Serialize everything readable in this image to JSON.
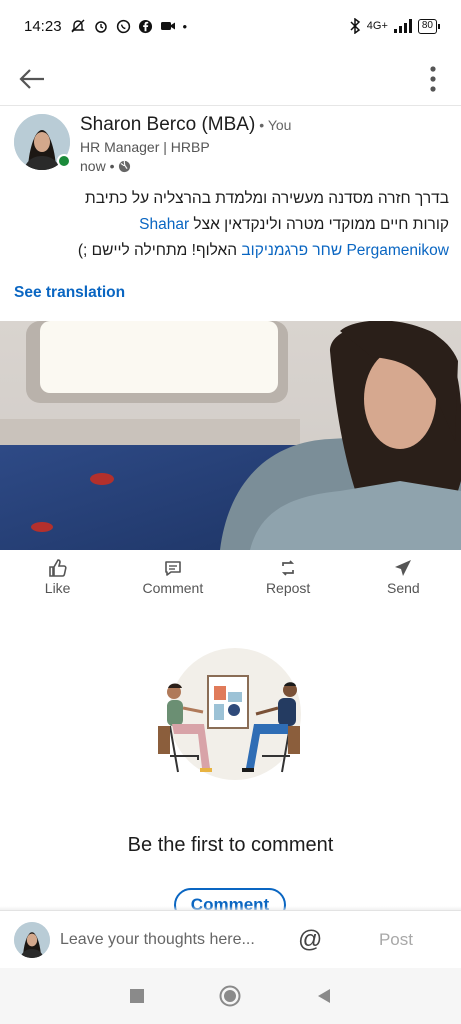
{
  "status_bar": {
    "time": "14:23",
    "network": "4G+",
    "battery": "80"
  },
  "post": {
    "author_name": "Sharon Berco (MBA)",
    "author_relation": "• You",
    "author_headline": "HR Manager | HRBP",
    "time": "now •",
    "text_line1": "בדרך חזרה מסדנה מעשירה ומלמדת בהרצליה על כתיבת",
    "text_line2_prefix": "קורות חיים ממוקדי מטרה ולינקדאין אצל ",
    "mention_en_first": "Shahar",
    "mention_en_last": "Pergamenikow",
    "mention_he": "שחר פרגמניקוב",
    "text_line3_suffix": " האלוף! מתחילה ליישם ;)",
    "see_translation": "See translation"
  },
  "actions": [
    {
      "label": "Like",
      "icon": "like-icon"
    },
    {
      "label": "Comment",
      "icon": "comment-icon"
    },
    {
      "label": "Repost",
      "icon": "repost-icon"
    },
    {
      "label": "Send",
      "icon": "send-icon"
    }
  ],
  "comments": {
    "empty_title": "Be the first to comment",
    "cta_label": "Comment"
  },
  "composer": {
    "placeholder": "Leave your thoughts here...",
    "mention_symbol": "@",
    "post_label": "Post"
  },
  "colors": {
    "accent": "#0a66c2",
    "online": "#1b8a3a"
  }
}
